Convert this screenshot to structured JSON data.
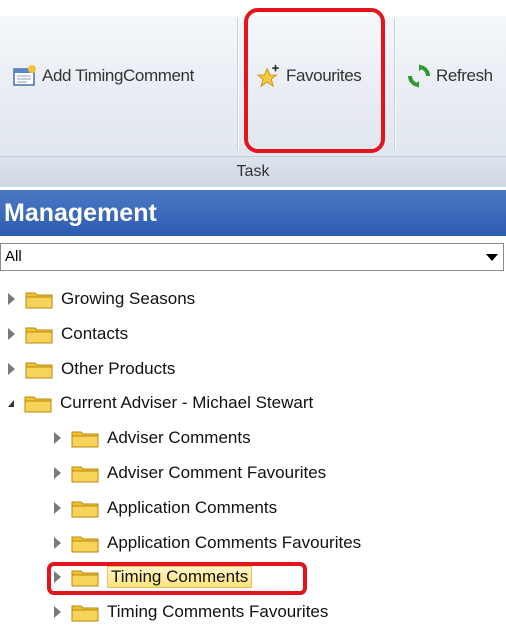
{
  "ribbon": {
    "buttons": [
      {
        "label": "Add TimingComment",
        "icon": "add-comment-icon"
      },
      {
        "label": "Favourites",
        "icon": "favourites-star-icon"
      },
      {
        "label": "Refresh",
        "icon": "refresh-icon"
      }
    ],
    "group_label": "Task"
  },
  "panel": {
    "title": "Management",
    "filter_value": "All"
  },
  "tree": {
    "items": [
      {
        "label": "Growing Seasons",
        "level": 0,
        "expanded": false
      },
      {
        "label": "Contacts",
        "level": 0,
        "expanded": false
      },
      {
        "label": "Other Products",
        "level": 0,
        "expanded": false
      },
      {
        "label": "Current Adviser - Michael Stewart",
        "level": 0,
        "expanded": true
      },
      {
        "label": "Adviser Comments",
        "level": 1,
        "expanded": false
      },
      {
        "label": "Adviser Comment Favourites",
        "level": 1,
        "expanded": false
      },
      {
        "label": "Application Comments",
        "level": 1,
        "expanded": false
      },
      {
        "label": "Application Comments Favourites",
        "level": 1,
        "expanded": false
      },
      {
        "label": "Timing Comments",
        "level": 1,
        "expanded": false,
        "selected": true
      },
      {
        "label": "Timing Comments Favourites",
        "level": 1,
        "expanded": false
      }
    ]
  },
  "colors": {
    "header_blue": "#2d5cb1",
    "highlight_red": "#e3141c",
    "folder_yellow": "#f2c12e",
    "selection_yellow": "#ffe27a"
  }
}
